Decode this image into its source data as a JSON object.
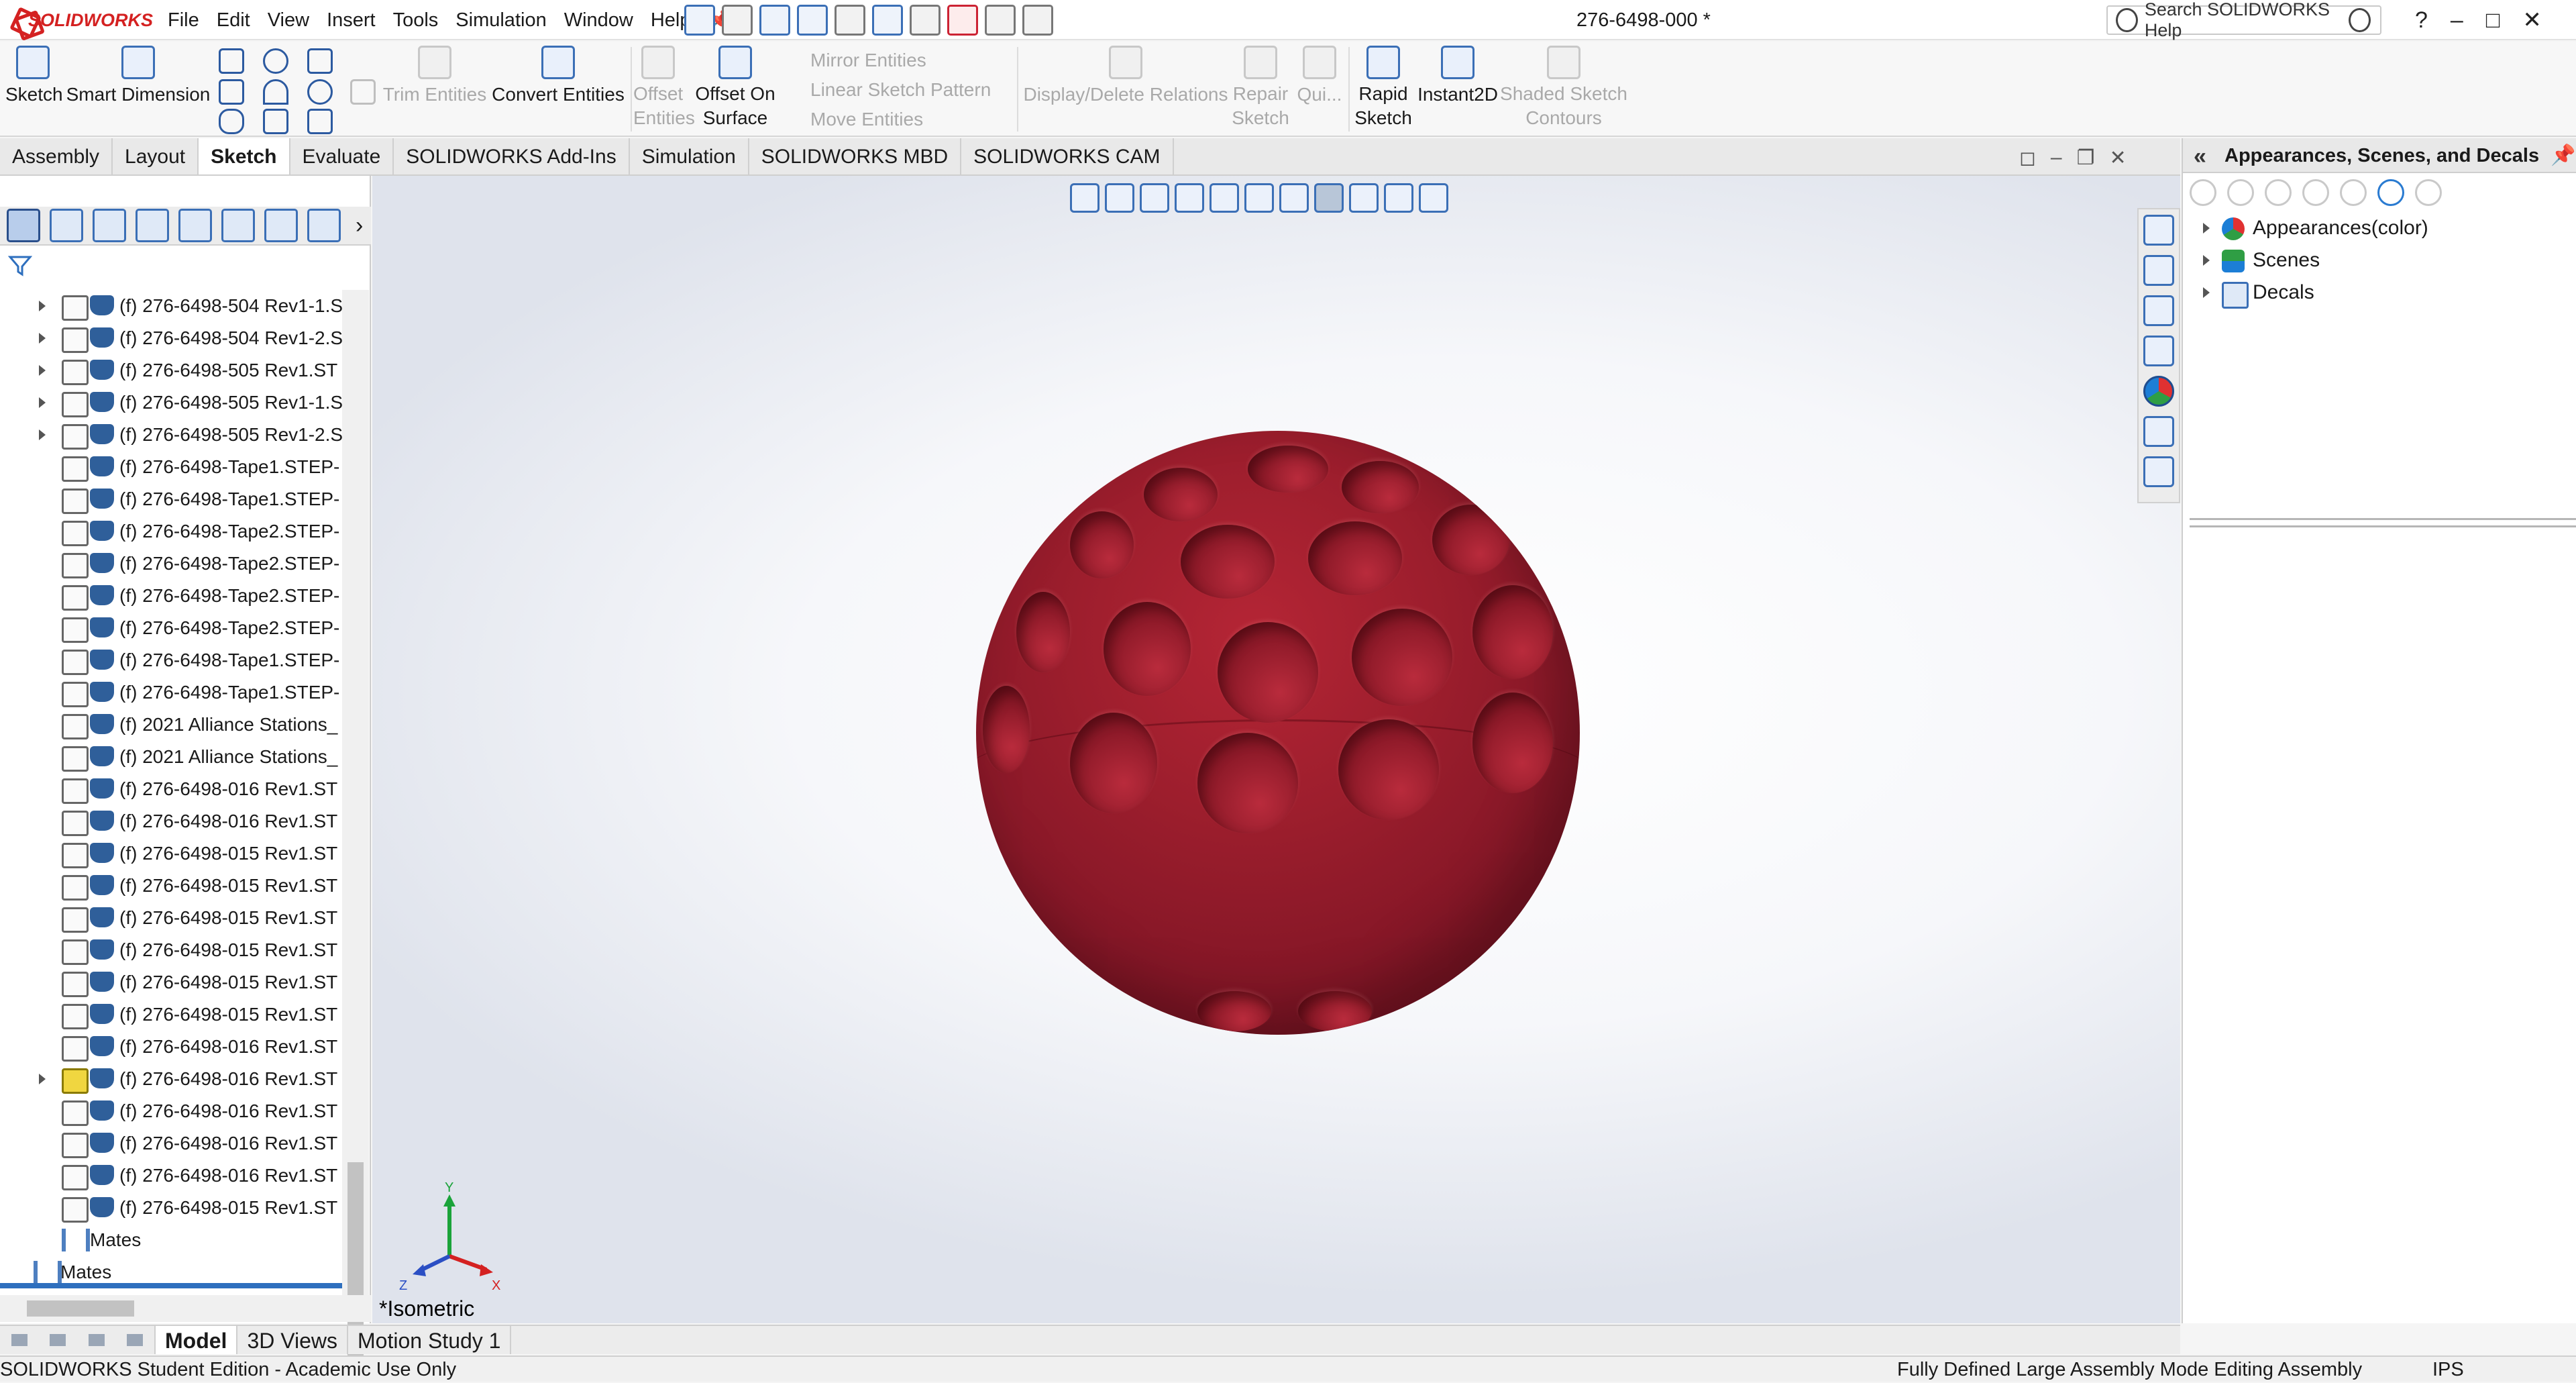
{
  "app": {
    "brand": "SOLIDWORKS",
    "document_title": "276-6498-000 *",
    "menu": [
      "File",
      "Edit",
      "View",
      "Insert",
      "Tools",
      "Simulation",
      "Window",
      "Help"
    ],
    "search_placeholder": "Search SOLIDWORKS Help",
    "window_controls": [
      "?",
      "–",
      "□",
      "✕"
    ]
  },
  "command_manager": {
    "sketch": "Sketch",
    "smart_dimension": "Smart Dimension",
    "trim_entities": "Trim Entities",
    "convert_entities": "Convert Entities",
    "offset_entities_1": "Offset",
    "offset_entities_2": "Entities",
    "offset_on_surface_1": "Offset On",
    "offset_on_surface_2": "Surface",
    "mirror_entities": "Mirror Entities",
    "linear_sketch_pattern": "Linear Sketch Pattern",
    "move_entities": "Move Entities",
    "display_delete_relations": "Display/Delete Relations",
    "repair_sketch_1": "Repair",
    "repair_sketch_2": "Sketch",
    "quick_snaps": "Qui...",
    "rapid_sketch_1": "Rapid",
    "rapid_sketch_2": "Sketch",
    "instant2d": "Instant2D",
    "shaded_sketch_1": "Shaded Sketch",
    "shaded_sketch_2": "Contours"
  },
  "tabs": [
    "Assembly",
    "Layout",
    "Sketch",
    "Evaluate",
    "SOLIDWORKS Add-Ins",
    "Simulation",
    "SOLIDWORKS MBD",
    "SOLIDWORKS CAM"
  ],
  "active_tab": "Sketch",
  "feature_tree": {
    "items": [
      {
        "label": "(f) 276-6498-504 Rev1-1.S",
        "expandable": true,
        "warn": false
      },
      {
        "label": "(f) 276-6498-504 Rev1-2.S",
        "expandable": true,
        "warn": false
      },
      {
        "label": "(f) 276-6498-505 Rev1.ST",
        "expandable": true,
        "warn": false
      },
      {
        "label": "(f) 276-6498-505 Rev1-1.S",
        "expandable": true,
        "warn": false
      },
      {
        "label": "(f) 276-6498-505 Rev1-2.S",
        "expandable": true,
        "warn": false
      },
      {
        "label": "(f) 276-6498-Tape1.STEP-",
        "expandable": false,
        "warn": false
      },
      {
        "label": "(f) 276-6498-Tape1.STEP-",
        "expandable": false,
        "warn": false
      },
      {
        "label": "(f) 276-6498-Tape2.STEP-",
        "expandable": false,
        "warn": false
      },
      {
        "label": "(f) 276-6498-Tape2.STEP-",
        "expandable": false,
        "warn": false
      },
      {
        "label": "(f) 276-6498-Tape2.STEP-",
        "expandable": false,
        "warn": false
      },
      {
        "label": "(f) 276-6498-Tape2.STEP-",
        "expandable": false,
        "warn": false
      },
      {
        "label": "(f) 276-6498-Tape1.STEP-",
        "expandable": false,
        "warn": false
      },
      {
        "label": "(f) 276-6498-Tape1.STEP-",
        "expandable": false,
        "warn": false
      },
      {
        "label": "(f) 2021 Alliance Stations_",
        "expandable": false,
        "warn": false
      },
      {
        "label": "(f) 2021 Alliance Stations_",
        "expandable": false,
        "warn": false
      },
      {
        "label": "(f) 276-6498-016 Rev1.ST",
        "expandable": false,
        "warn": false
      },
      {
        "label": "(f) 276-6498-016 Rev1.ST",
        "expandable": false,
        "warn": false
      },
      {
        "label": "(f) 276-6498-015 Rev1.ST",
        "expandable": false,
        "warn": false
      },
      {
        "label": "(f) 276-6498-015 Rev1.ST",
        "expandable": false,
        "warn": false
      },
      {
        "label": "(f) 276-6498-015 Rev1.ST",
        "expandable": false,
        "warn": false
      },
      {
        "label": "(f) 276-6498-015 Rev1.ST",
        "expandable": false,
        "warn": false
      },
      {
        "label": "(f) 276-6498-015 Rev1.ST",
        "expandable": false,
        "warn": false
      },
      {
        "label": "(f) 276-6498-015 Rev1.ST",
        "expandable": false,
        "warn": false
      },
      {
        "label": "(f) 276-6498-016 Rev1.ST",
        "expandable": false,
        "warn": false
      },
      {
        "label": "(f) 276-6498-016 Rev1.ST",
        "expandable": true,
        "warn": true
      },
      {
        "label": "(f) 276-6498-016 Rev1.ST",
        "expandable": false,
        "warn": false
      },
      {
        "label": "(f) 276-6498-016 Rev1.ST",
        "expandable": false,
        "warn": false
      },
      {
        "label": "(f) 276-6498-016 Rev1.ST",
        "expandable": false,
        "warn": false
      },
      {
        "label": "(f) 276-6498-015 Rev1.ST",
        "expandable": false,
        "warn": false
      }
    ],
    "mates_inner": "Mates",
    "mates_outer": "Mates"
  },
  "viewport": {
    "view_name": "*Isometric",
    "model_color": "#9d1e2d",
    "triad": {
      "x": "X",
      "y": "Y",
      "z": "Z"
    }
  },
  "task_pane": {
    "title": "Appearances, Scenes, and Decals",
    "items": [
      {
        "label": "Appearances(color)",
        "icon": "appearances-icon"
      },
      {
        "label": "Scenes",
        "icon": "scenes-icon"
      },
      {
        "label": "Decals",
        "icon": "decals-icon"
      }
    ]
  },
  "bottom_tabs": [
    "Model",
    "3D Views",
    "Motion Study 1"
  ],
  "active_bottom_tab": "Model",
  "status": {
    "left": "SOLIDWORKS Student Edition - Academic Use Only",
    "right": "Fully Defined  Large Assembly Mode  Editing Assembly",
    "units": "IPS"
  }
}
